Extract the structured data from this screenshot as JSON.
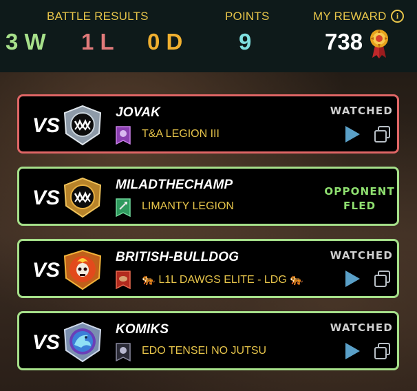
{
  "header": {
    "battle_results_label": "BATTLE RESULTS",
    "wins": "3 W",
    "losses": "1 L",
    "draws": "0 D",
    "points_label": "POINTS",
    "points": "9",
    "reward_label": "MY REWARD",
    "reward": "738",
    "colors": {
      "wins": "#a6e08a",
      "losses": "#e07a7a",
      "draws": "#f0b030",
      "points": "#7fe0e0",
      "label": "#e6c44a"
    }
  },
  "battles": [
    {
      "vs": "VS",
      "player": "JOVAK",
      "guild": "T&A LEGION III",
      "status": "WATCHED",
      "result": "loss",
      "badge_icon": "silver-fang-badge-icon",
      "guild_icon": "purple-guild-banner-icon"
    },
    {
      "vs": "VS",
      "player": "MILADTHECHAMP",
      "guild": "LIMANTY LEGION",
      "status_line1": "OPPONENT",
      "status_line2": "FLED",
      "result": "win",
      "badge_icon": "gold-fang-badge-icon",
      "guild_icon": "green-guild-banner-icon"
    },
    {
      "vs": "VS",
      "player": "BRITISH-BULLDOG",
      "guild": "🐅 L1L DAWGS ELITE - LDG 🐅",
      "status": "WATCHED",
      "result": "win",
      "badge_icon": "fire-skull-badge-icon",
      "guild_icon": "red-guild-banner-icon"
    },
    {
      "vs": "VS",
      "player": "KOMIKS",
      "guild": "EDO TENSEI NO JUTSU",
      "status": "WATCHED",
      "result": "win",
      "badge_icon": "blue-dragon-badge-icon",
      "guild_icon": "dark-guild-banner-icon"
    }
  ]
}
